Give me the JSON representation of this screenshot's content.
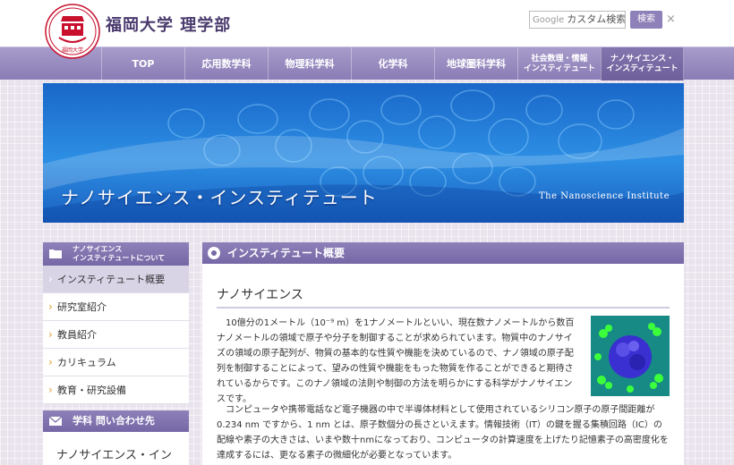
{
  "header": {
    "site_title": "福岡大学 理学部",
    "logo_text": "福岡大学",
    "search": {
      "google_label": "Google",
      "placeholder": "カスタム検索",
      "button_label": "検索",
      "clear_label": "×"
    }
  },
  "nav": {
    "items": [
      {
        "label": "TOP"
      },
      {
        "label": "応用数学科"
      },
      {
        "label": "物理科学科"
      },
      {
        "label": "化学科"
      },
      {
        "label": "地球圏科学科"
      },
      {
        "label_line1": "社会数理・情報",
        "label_line2": "インスティテュート"
      },
      {
        "label_line1": "ナノサイエンス・",
        "label_line2": "インスティテュート"
      }
    ]
  },
  "banner": {
    "title": "ナノサイエンス・インスティテュート",
    "subtitle": "The Nanoscience Institute"
  },
  "sidebar": {
    "section1": {
      "line1": "ナノサイエンス",
      "line2": "インスティテュートについて"
    },
    "items": [
      {
        "label": "インスティテュート概要"
      },
      {
        "label": "研究室紹介"
      },
      {
        "label": "教員紹介"
      },
      {
        "label": "カリキュラム"
      },
      {
        "label": "教育・研究設備"
      }
    ],
    "section2": {
      "label": "学科 問い合わせ先"
    },
    "contact_name": "ナノサイエンス・イン"
  },
  "main": {
    "heading": "インスティテュート概要",
    "section_title": "ナノサイエンス",
    "paragraph1": "10億分の1メートル（10⁻⁹ m）を1ナノメートルといい、現在数ナノメートルから数百ナノメートルの領域で原子や分子を制御することが求められています。物質中のナノサイズの領域の原子配列が、物質の基本的な性質や機能を決めているので、ナノ領域の原子配列を制御することによって、望みの性質や機能をもった物質を作ることができると期待されているからです。このナノ領域の法則や制御の方法を明らかにする科学がナノサイエンスです。",
    "paragraph2": "コンピュータや携帯電話など電子機器の中で半導体材料として使用されているシリコン原子の原子間距離が0.234 nm ですから、1 nm とは、原子数個分の長さといえます。情報技術（IT）の鍵を握る集積回路（IC）の配線や素子の大きさは、いまや数十nmになっており、コンピュータの計算速度を上げたり記憶素子の高密度化を達成するには、更なる素子の微細化が必要となっています。"
  },
  "colors": {
    "accent": "#7667a6",
    "nav": "#8a7cb5",
    "banner": "#2d8fe4"
  }
}
